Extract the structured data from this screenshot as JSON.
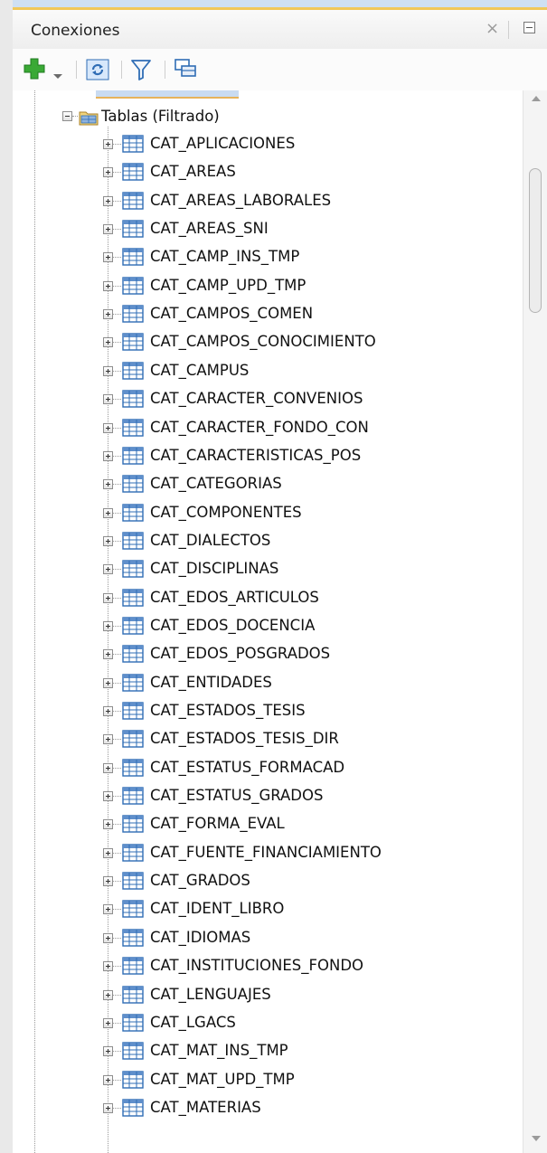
{
  "header": {
    "title": "Conexiones",
    "close_icon": "close-icon",
    "minimize_icon": "minimize-icon"
  },
  "toolbar": {
    "items": [
      "add-connection-icon",
      "dropdown-arrow-icon",
      "refresh-icon",
      "filter-icon",
      "schema-browser-icon"
    ]
  },
  "tree": {
    "folder": {
      "label": "Tablas (Filtrado)",
      "icon": "folder-icon"
    },
    "tables": [
      "CAT_APLICACIONES",
      "CAT_AREAS",
      "CAT_AREAS_LABORALES",
      "CAT_AREAS_SNI",
      "CAT_CAMP_INS_TMP",
      "CAT_CAMP_UPD_TMP",
      "CAT_CAMPOS_COMEN",
      "CAT_CAMPOS_CONOCIMIENTO",
      "CAT_CAMPUS",
      "CAT_CARACTER_CONVENIOS",
      "CAT_CARACTER_FONDO_CON",
      "CAT_CARACTERISTICAS_POS",
      "CAT_CATEGORIAS",
      "CAT_COMPONENTES",
      "CAT_DIALECTOS",
      "CAT_DISCIPLINAS",
      "CAT_EDOS_ARTICULOS",
      "CAT_EDOS_DOCENCIA",
      "CAT_EDOS_POSGRADOS",
      "CAT_ENTIDADES",
      "CAT_ESTADOS_TESIS",
      "CAT_ESTADOS_TESIS_DIR",
      "CAT_ESTATUS_FORMACAD",
      "CAT_ESTATUS_GRADOS",
      "CAT_FORMA_EVAL",
      "CAT_FUENTE_FINANCIAMIENTO",
      "CAT_GRADOS",
      "CAT_IDENT_LIBRO",
      "CAT_IDIOMAS",
      "CAT_INSTITUCIONES_FONDO",
      "CAT_LENGUAJES",
      "CAT_LGACS",
      "CAT_MAT_INS_TMP",
      "CAT_MAT_UPD_TMP",
      "CAT_MATERIAS"
    ]
  },
  "colors": {
    "accent": "#f1c85a",
    "selection": "#c9dbf1",
    "add_green": "#3aa935",
    "icon_blue": "#2f6db5"
  }
}
